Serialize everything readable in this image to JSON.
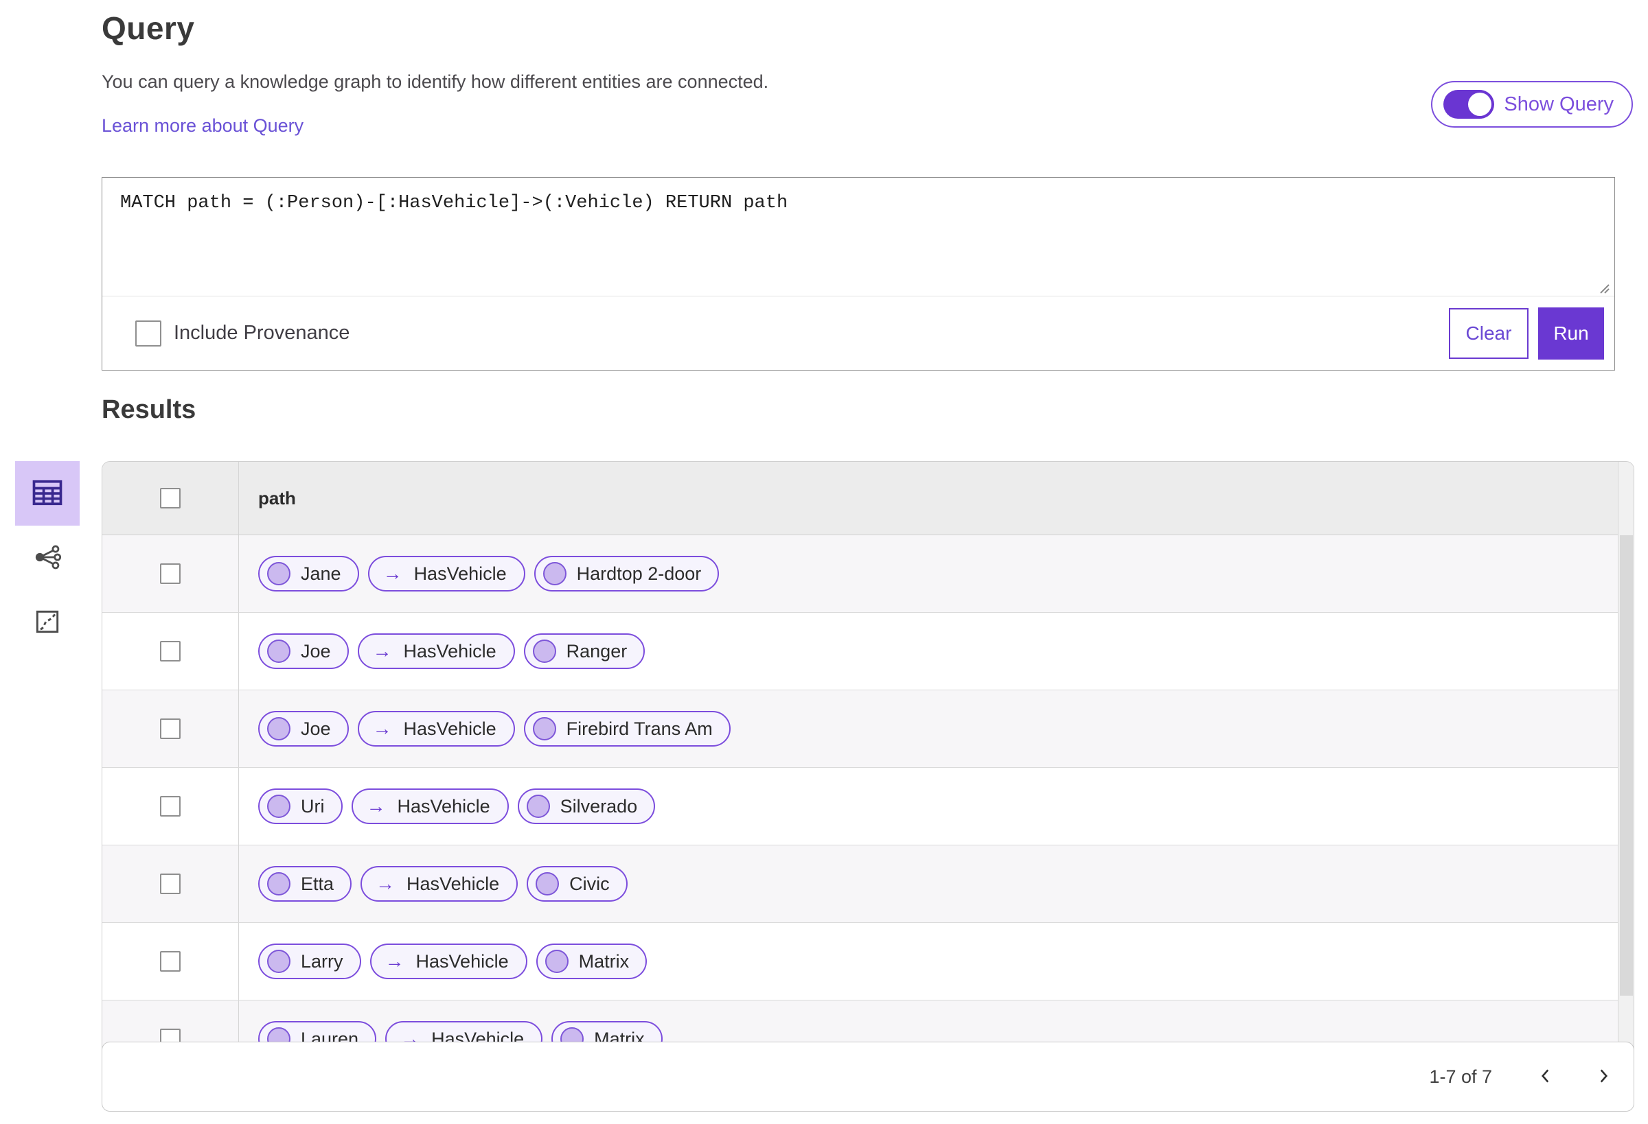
{
  "header": {
    "title": "Query",
    "description": "You can query a knowledge graph to identify how different entities are connected.",
    "learn_more_link": "Learn more about Query",
    "show_query_label": "Show Query",
    "show_query_on": true
  },
  "query_panel": {
    "query_text": "MATCH path = (:Person)-[:HasVehicle]->(:Vehicle) RETURN path",
    "include_provenance_label": "Include Provenance",
    "include_provenance_checked": false,
    "clear_label": "Clear",
    "run_label": "Run"
  },
  "results": {
    "title": "Results",
    "views": [
      {
        "id": "table",
        "selected": true
      },
      {
        "id": "link-chart",
        "selected": false
      },
      {
        "id": "map",
        "selected": false
      }
    ],
    "table": {
      "column_header": "path",
      "rows": [
        {
          "source": "Jane",
          "relationship": "HasVehicle",
          "target": "Hardtop 2-door"
        },
        {
          "source": "Joe",
          "relationship": "HasVehicle",
          "target": "Ranger"
        },
        {
          "source": "Joe",
          "relationship": "HasVehicle",
          "target": "Firebird Trans Am"
        },
        {
          "source": "Uri",
          "relationship": "HasVehicle",
          "target": "Silverado"
        },
        {
          "source": "Etta",
          "relationship": "HasVehicle",
          "target": "Civic"
        },
        {
          "source": "Larry",
          "relationship": "HasVehicle",
          "target": "Matrix"
        },
        {
          "source": "Lauren",
          "relationship": "HasVehicle",
          "target": "Matrix"
        }
      ]
    },
    "pagination": {
      "range_label": "1-7 of 7"
    }
  },
  "icons": {
    "arrow_right": "→"
  },
  "colors": {
    "accent": "#6a38d2",
    "accent_outline": "#7c4fdd",
    "pill_background": "#f6f4fd",
    "node_fill": "#cbb9ef",
    "selected_view_background": "#d8c7f7",
    "link": "#6a52d6"
  }
}
